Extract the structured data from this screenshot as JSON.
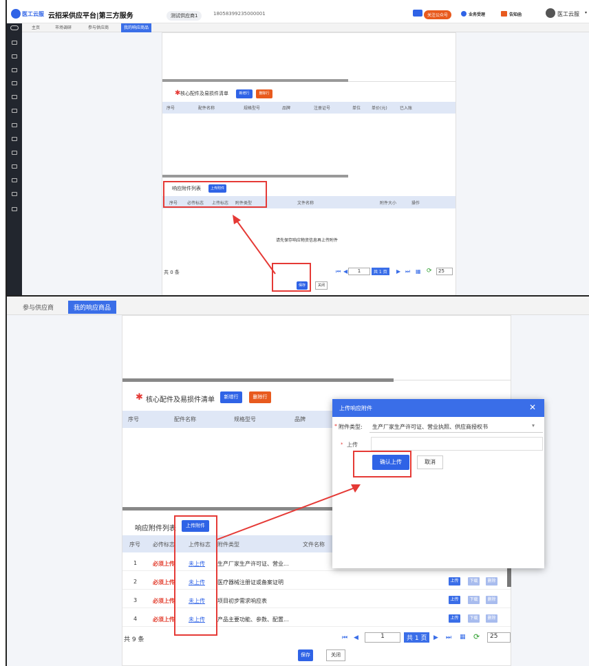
{
  "topbar": {
    "logo_text": "医工云服",
    "platform_title": "云招采供应平台|第三方服务",
    "supplier": "测试供应商1",
    "phone": "18058399235000001",
    "follow_label": "关注公众号",
    "business_label": "业务受理",
    "notice_label": "告知函",
    "user_name": "医工云服"
  },
  "tabs": [
    "主页",
    "市场调研",
    "参与供应商",
    "我的响应商品"
  ],
  "tabs2": [
    "参与供应商",
    "我的响应商品"
  ],
  "parts": {
    "title": "核心配件及易损件清单",
    "add_label": "新增行",
    "delete_label": "删除行",
    "headers": [
      "序号",
      "配件名称",
      "规格型号",
      "品牌",
      "注册证号",
      "单位",
      "单价(元)",
      "已入账"
    ]
  },
  "attach": {
    "title": "响应附件列表",
    "upload_label": "上传附件",
    "headers": [
      "序号",
      "必传标志",
      "上传标志",
      "附件类型",
      "文件名称",
      "附件大小",
      "操作"
    ],
    "empty_hint": "请先保存响应物资信息再上传附件",
    "total": "共 0 条",
    "page_input": "1",
    "page_text": "共 1 页",
    "page_size": "25"
  },
  "footer": {
    "save_label": "保存",
    "close_label": "关闭"
  },
  "attach2": {
    "title": "响应附件列表",
    "upload_label": "上传附件",
    "headers": [
      "序号",
      "必传标志",
      "上传标志",
      "附件类型",
      "文件名称"
    ],
    "rows": [
      {
        "no": "1",
        "must": "必须上传",
        "status": "未上传",
        "type": "生产厂家生产许可证、营业..."
      },
      {
        "no": "2",
        "must": "必须上传",
        "status": "未上传",
        "type": "医疗器械注册证或备案证明"
      },
      {
        "no": "3",
        "must": "必须上传",
        "status": "未上传",
        "type": "项目初步需求响应表"
      },
      {
        "no": "4",
        "must": "必须上传",
        "status": "未上传",
        "type": "产品主要功能、参数、配置..."
      }
    ],
    "row_actions": [
      "上传",
      "下载",
      "删除"
    ],
    "total": "共 9 条",
    "page_input": "1",
    "page_text": "共 1 页",
    "page_size": "25"
  },
  "parts2": {
    "title": "核心配件及易损件清单",
    "add_label": "新增行",
    "delete_label": "删除行",
    "headers": [
      "序号",
      "配件名称",
      "规格型号",
      "品牌"
    ]
  },
  "modal": {
    "title": "上传响应附件",
    "type_label": "附件类型:",
    "type_value": "生产厂家生产许可证、营业执照、供应商授权书",
    "upload_label": "上传",
    "confirm_label": "确认上传",
    "cancel_label": "取消"
  },
  "colors": {
    "accent": "#2f63e6",
    "danger": "#e53935",
    "orange": "#e85a1e"
  }
}
